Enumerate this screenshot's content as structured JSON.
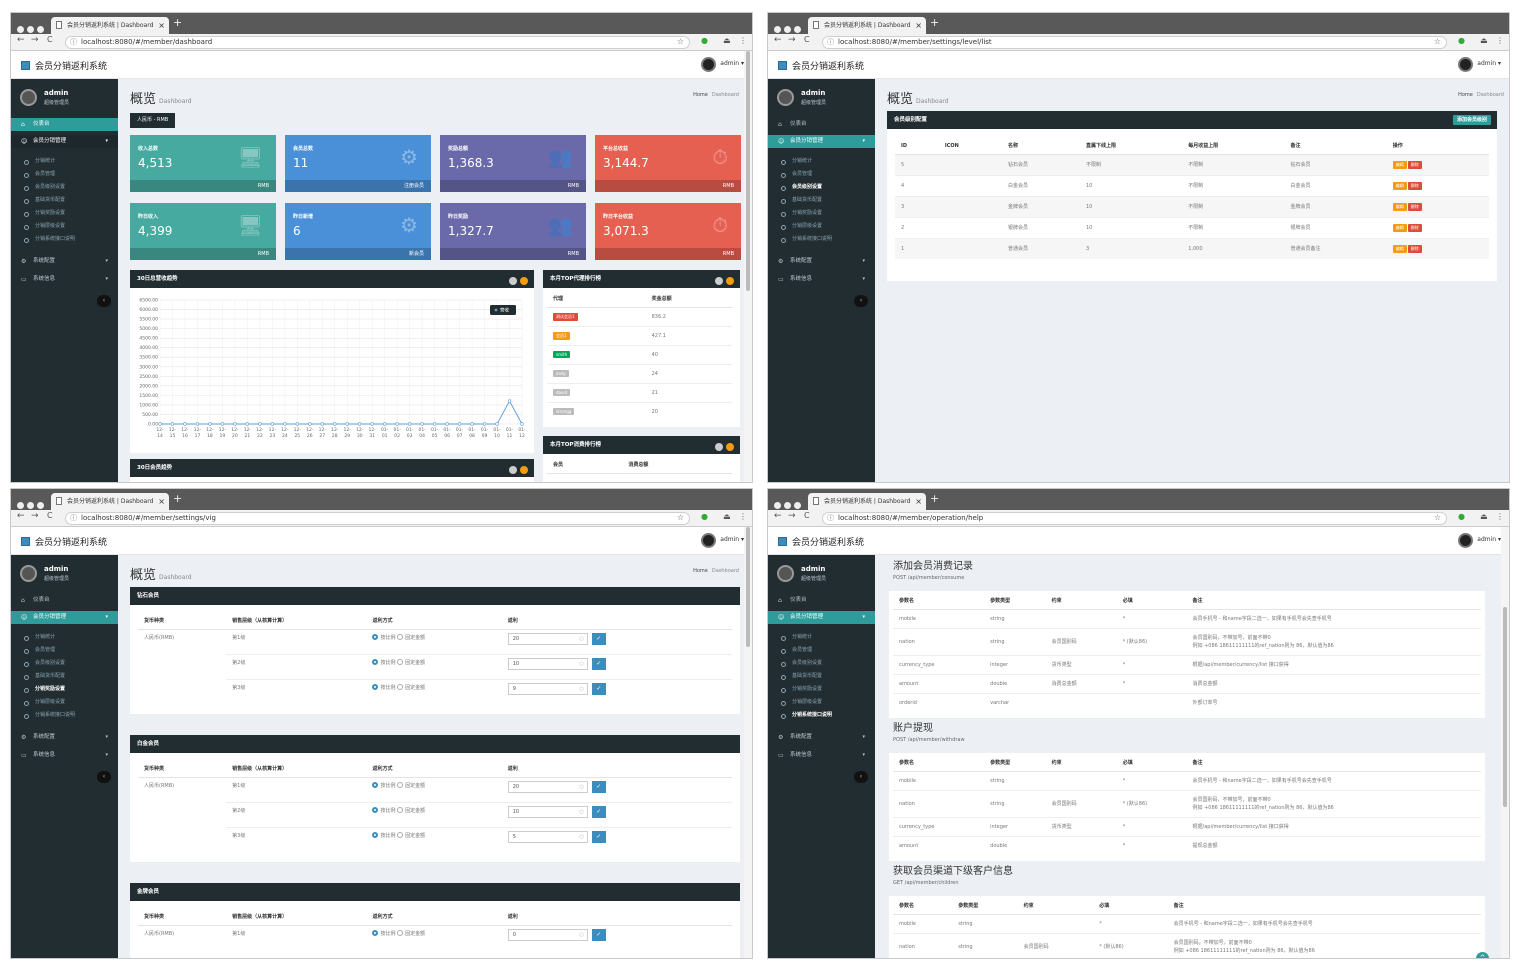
{
  "browser": {
    "tab_title": "会员分销返利系统 | Dashboard",
    "new_tab": "+",
    "close": "×",
    "back": "←",
    "forward": "→",
    "reload": "C",
    "info": "ⓘ",
    "star": "☆",
    "menu": "⋮"
  },
  "app": {
    "brand": "会员分销返利系统",
    "user": "admin ▾",
    "sidebar_user": "admin",
    "sidebar_role": "超级管理员",
    "menu": {
      "dashboard": "仪表台",
      "member_group": "会员分销管理",
      "system_config": "系统配置",
      "system_info": "系统信息",
      "subs": [
        "分销统计",
        "会员管理",
        "会员级别设置",
        "基础货币配置",
        "分销奖励设置",
        "分销层级设置",
        "分销系统接口说明"
      ]
    },
    "collapse": "‹"
  },
  "page": {
    "title": "概览",
    "subtitle": "Dashboard",
    "crumb_home": "Home",
    "crumb_current": "Dashboard"
  },
  "windows": [
    {
      "url": "localhost:8080/#/member/dashboard"
    },
    {
      "url": "localhost:8080/#/member/settings/level/list"
    },
    {
      "url": "localhost:8080/#/member/settings/vig"
    },
    {
      "url": "localhost:8080/#/member/operation/help"
    }
  ],
  "dashboard": {
    "currency": "人民币 - RMB",
    "cards": [
      {
        "label": "收入总数",
        "value": "4,513",
        "foot": "RMB",
        "color": "#47aaa0"
      },
      {
        "label": "会员总数",
        "value": "11",
        "foot": "注册会员",
        "color": "#4a90d9"
      },
      {
        "label": "奖励总额",
        "value": "1,368.3",
        "foot": "RMB",
        "color": "#6a69a9"
      },
      {
        "label": "平台总收益",
        "value": "3,144.7",
        "foot": "RMB",
        "color": "#e66052"
      },
      {
        "label": "昨日收入",
        "value": "4,399",
        "foot": "RMB",
        "color": "#47aaa0"
      },
      {
        "label": "昨日新增",
        "value": "6",
        "foot": "新会员",
        "color": "#4a90d9"
      },
      {
        "label": "昨日奖励",
        "value": "1,327.7",
        "foot": "RMB",
        "color": "#6a69a9"
      },
      {
        "label": "昨日平台收益",
        "value": "3,071.3",
        "foot": "RMB",
        "color": "#e66052"
      }
    ],
    "chart_title": "30日总营收趋势",
    "chart2_title": "30日会员趋势",
    "top_agents_title": "本月TOP代理排行榜",
    "top_agents_cols": [
      "代理",
      "奖金总额"
    ],
    "top_agents": [
      {
        "name": "测试会员1",
        "value": "836.2",
        "color": "#dd4b39"
      },
      {
        "name": "会员1",
        "value": "427.1",
        "color": "#f39c12"
      },
      {
        "name": "smith",
        "value": "40",
        "color": "#00a65a"
      },
      {
        "name": "andy",
        "value": "24",
        "color": "#bbbbbb"
      },
      {
        "name": "david",
        "value": "21",
        "color": "#bbbbbb"
      },
      {
        "name": "strongg",
        "value": "20",
        "color": "#bbbbbb"
      }
    ],
    "top_consumers_title": "本月TOP消费排行榜",
    "top_consumers_cols": [
      "会员",
      "消费总额"
    ]
  },
  "chart_data": {
    "type": "line",
    "title": "30日总营收趋势",
    "series": [
      {
        "name": "营收",
        "values": [
          0,
          0,
          0,
          0,
          0,
          0,
          0,
          0,
          0,
          0,
          0,
          0,
          0,
          0,
          0,
          0,
          0,
          0,
          0,
          0,
          0,
          0,
          0,
          0,
          0,
          0,
          0,
          0,
          1200,
          0,
          5800
        ]
      }
    ],
    "x": [
      "12-14",
      "12-15",
      "12-16",
      "12-17",
      "12-18",
      "12-19",
      "12-20",
      "12-21",
      "12-22",
      "12-23",
      "12-24",
      "12-25",
      "12-26",
      "12-27",
      "12-28",
      "12-29",
      "12-30",
      "12-31",
      "01-01",
      "01-02",
      "01-03",
      "01-04",
      "01-05",
      "01-06",
      "01-07",
      "01-08",
      "01-09",
      "01-10",
      "01-11",
      "01-12"
    ],
    "yticks": [
      "0.00",
      "500.00",
      "1000.00",
      "1500.00",
      "2000.00",
      "2500.00",
      "3000.00",
      "3500.00",
      "4000.00",
      "4500.00",
      "5000.00",
      "5500.00",
      "6000.00",
      "6500.00"
    ],
    "ylim": [
      0,
      6500
    ],
    "legend": "营收",
    "grid": true
  },
  "levels": {
    "title": "会员级别配置",
    "add": "添加会员级别",
    "cols": [
      "ID",
      "ICON",
      "名称",
      "直属下线上限",
      "每月收益上限",
      "备注",
      "操作"
    ],
    "rows": [
      [
        "5",
        "",
        "钻石会员",
        "不限制",
        "不限制",
        "钻石会员"
      ],
      [
        "4",
        "",
        "白金会员",
        "10",
        "不限制",
        "白金会员"
      ],
      [
        "3",
        "",
        "金牌会员",
        "10",
        "不限制",
        "金牌会员"
      ],
      [
        "2",
        "",
        "银牌会员",
        "10",
        "不限制",
        "银牌会员"
      ],
      [
        "1",
        "",
        "普通会员",
        "3",
        "1,000",
        "普通会员备注"
      ]
    ],
    "edit": "编辑",
    "del": "删除"
  },
  "rewards": {
    "cols": [
      "货币种类",
      "销售层级（从核算计算）",
      "返利方式",
      "返利"
    ],
    "currency": "人民币(RMB)",
    "opt_ratio": "按比例",
    "opt_fixed": "固定金额",
    "ok": "✓",
    "groups": [
      {
        "name": "钻石会员",
        "rows": [
          {
            "lv": "第1级",
            "v": "20"
          },
          {
            "lv": "第2级",
            "v": "10"
          },
          {
            "lv": "第3级",
            "v": "9"
          }
        ]
      },
      {
        "name": "白金会员",
        "rows": [
          {
            "lv": "第1级",
            "v": "20"
          },
          {
            "lv": "第2级",
            "v": "10"
          },
          {
            "lv": "第3级",
            "v": "5"
          }
        ]
      },
      {
        "name": "金牌会员",
        "rows": [
          {
            "lv": "第1级",
            "v": "0"
          }
        ]
      }
    ]
  },
  "help": {
    "cols": [
      "参数名",
      "参数类型",
      "约束",
      "必填",
      "备注"
    ],
    "sections": [
      {
        "title": "添加会员消费记录",
        "endpoint": "POST /api/member/consume",
        "rows": [
          [
            "mobile",
            "string",
            "",
            "*",
            "会员手机号 - 和name字段二选一，如果有手机号会先查手机号"
          ],
          [
            "nation",
            "string",
            "会员国别码",
            "* (默认86)",
            "会员国别码，不带加号，前面不带0\n例如 +086 18611111111的ref_nation则为 86，默认值为86"
          ],
          [
            "currency_type",
            "integer",
            "货币类型",
            "*",
            "根据/api/member/currency/list 接口获得"
          ],
          [
            "amount",
            "double",
            "消费总金额",
            "*",
            "消费总金额"
          ],
          [
            "orderid",
            "varchar",
            "",
            "",
            "外部订单号"
          ]
        ]
      },
      {
        "title": "账户提现",
        "endpoint": "POST /api/member/withdraw",
        "rows": [
          [
            "mobile",
            "string",
            "",
            "*",
            "会员手机号 - 和name字段二选一，如果有手机号会先查手机号"
          ],
          [
            "nation",
            "string",
            "会员国别码",
            "* (默认86)",
            "会员国别码，不带加号，前面不带0\n例如 +086 18611111111的ref_nation则为 86，默认值为86"
          ],
          [
            "currency_type",
            "integer",
            "货币类型",
            "*",
            "根据/api/member/currency/list 接口获得"
          ],
          [
            "amount",
            "double",
            "",
            "*",
            "提现总金额"
          ]
        ]
      },
      {
        "title": "获取会员渠道下级客户信息",
        "endpoint": "GET /api/member/children",
        "rows": [
          [
            "mobile",
            "string",
            "",
            "*",
            "会员手机号 - 和name字段二选一，如果有手机号会先查手机号"
          ],
          [
            "nation",
            "string",
            "会员国别码",
            "* (默认86)",
            "会员国别码，不带加号，前面不带0\n例如 +086 18611111111的ref_nation则为 86，默认值为86"
          ]
        ]
      }
    ],
    "fab": "^"
  }
}
